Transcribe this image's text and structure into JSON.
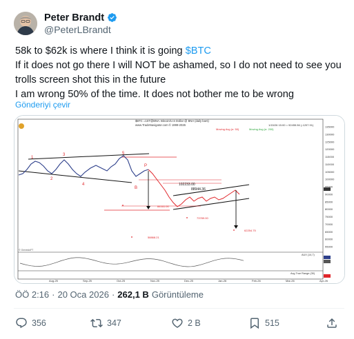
{
  "author": {
    "name": "Peter Brandt",
    "handle": "@PeterLBrandt"
  },
  "tweet": {
    "line1_prefix": "58k to $62k is where I think it is going ",
    "cashtag": "$BTC",
    "line2": "If it does not go there I will NOT be ashamed, so I do not need to see you",
    "line3": "trolls screen shot this in the future",
    "line4": "I am wrong 50% of the time. It does not bother me to be wrong",
    "translate_label": "Gönderiyi çevir"
  },
  "chart": {
    "header_text": "$BTC =1ST@BNA: Bitcoin/U.S Dollar @ BNA (daily bars)",
    "subheader_text": "www.TradeNavigator.com © 1999-2026",
    "top_right_text": "1/15/26 15:00 = 92455.56 (-1207.91)",
    "legend_left": "Moving Avg (n: 50)",
    "legend_right": "Moving Avg (n: 200)",
    "wave_labels": [
      "1",
      "2",
      "3",
      "4",
      "5",
      "P",
      "B"
    ],
    "level_labels": [
      "102233.00",
      "88944.36",
      "84161.00",
      "73789.00",
      "62254.75",
      "58868.21"
    ],
    "y_axis": [
      "135000",
      "130000",
      "125000",
      "120000",
      "115000",
      "110000",
      "105000",
      "100000",
      "95000",
      "90000",
      "85000",
      "80000",
      "75000",
      "70000",
      "65000",
      "60000",
      "55000"
    ],
    "atr_label": "Avg True Range (30)",
    "aux_label": "AUX (14,7)",
    "watermark": "© GenesisFT",
    "x_axis": [
      "Aug-25",
      "Sep-25",
      "Oct-25",
      "Nov-25",
      "Dec-25",
      "Jan-26",
      "Feb-26",
      "Mar-26",
      "Apr-26"
    ]
  },
  "meta": {
    "time": "ÖÖ 2:16",
    "date": "20 Oca 2026",
    "dot": "·",
    "views": "262,1 B",
    "views_label": "Görüntüleme"
  },
  "actions": {
    "replies": "356",
    "reposts": "347",
    "likes": "2 B",
    "bookmarks": "515"
  },
  "colors": {
    "accent": "#1d9bf0",
    "verified": "#1d9bf0",
    "chart_red": "#e0262b",
    "chart_green": "#2aa63a"
  }
}
